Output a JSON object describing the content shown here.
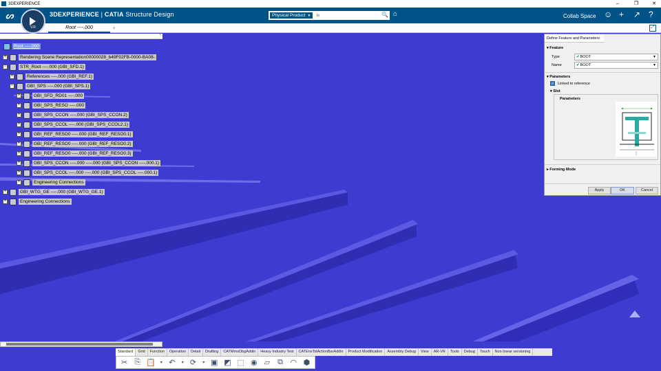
{
  "window": {
    "title": "3DEXPERIENCE"
  },
  "app": {
    "brand_prefix": "3DEXPERIENCE",
    "brand_sep": " | ",
    "brand_product": "CATIA",
    "brand_app": " Structure Design",
    "compass_version": "V.R",
    "search_context": "Physical Product",
    "search_placeholder": "te",
    "collab_space": "Collab Space"
  },
  "tabs": {
    "active": "Root ----.000",
    "add": "+"
  },
  "tree": {
    "nodes": [
      {
        "label": "Root ----.000",
        "root": true
      },
      {
        "label": "Rendering Scene Representation00000028_b49F02FB-0000-BA08-"
      },
      {
        "label": "STR_Root ----.000 (GBI_SFD.1)"
      },
      {
        "label": "References ----.000 (GBI_REF.1)"
      },
      {
        "label": "GBI_SPS ----.000 (GBI_SPS.1)"
      },
      {
        "label": "GBI_SFD_RD01 ----.000"
      },
      {
        "label": "GBI_SPS_RESO ----.000"
      },
      {
        "label": "GBI_SPS_CCON ----.000 (GBI_SPS_CCON.2)"
      },
      {
        "label": "GBI_SPS_CCOL ----.000 (GBI_SPS_CCOL2.1)"
      },
      {
        "label": "GBI_REF_RESO0 ----.000 (GBI_REF_RESO0.1)"
      },
      {
        "label": "GBI_REF_RESO0 ----.000 (GBI_REF_RESO0.2)"
      },
      {
        "label": "GBI_REF_RESO0 ----.000 (GBI_REF_RESO0.3)"
      },
      {
        "label": "GBI_SPS_CCON ----.000 ----.000 (GBI_SPS_CCON ----.000.1)"
      },
      {
        "label": "GBI_SPS_CCOL ----.000 ----.000 (GBI_SPS_CCOL ----.000.1)"
      },
      {
        "label": "Engineering Connections"
      },
      {
        "label": "GBI_WTG_GE ----.000 (GBI_WTG_GE.1)"
      },
      {
        "label": "Engineering Connections"
      }
    ]
  },
  "panel": {
    "title": "Define Feature and Parameters",
    "feature_section": "Feature",
    "type_label": "Type",
    "type_value": "BOOT",
    "name_label": "Name",
    "name_value": "BOOT",
    "parameters_section": "Parameters",
    "linked_label": "Linked to reference",
    "slot_section": "Slot",
    "group_label": "Parameters",
    "forming_section": "Forming Mode",
    "apply": "Apply",
    "ok": "OK",
    "cancel": "Cancel"
  },
  "action_tabs": [
    "Standard",
    "Grid",
    "Function",
    "Operation",
    "Detail",
    "Drafting",
    "CATMmoDbgAddin",
    "Heavy Industry Test",
    "CATEnsTstActionBarAddin",
    "Product Modification",
    "Assembly Debug",
    "View",
    "AR-VR",
    "Tools",
    "Debug",
    "Touch",
    "Non linear versioning"
  ],
  "active_action_tab": "Standard",
  "colors": {
    "app_bar": "#005386",
    "viewport": "#3d3bd0",
    "tree_root": "#7a99e8",
    "check_green": "#2e9c3a"
  },
  "tools": [
    "cut-icon",
    "copy-icon",
    "paste-icon",
    "undo-icon",
    "update-icon",
    "product-icon",
    "part-icon",
    "shape-icon",
    "drawing-icon",
    "representation-icon",
    "assembly-icon",
    "surface-icon",
    "solid-icon"
  ]
}
